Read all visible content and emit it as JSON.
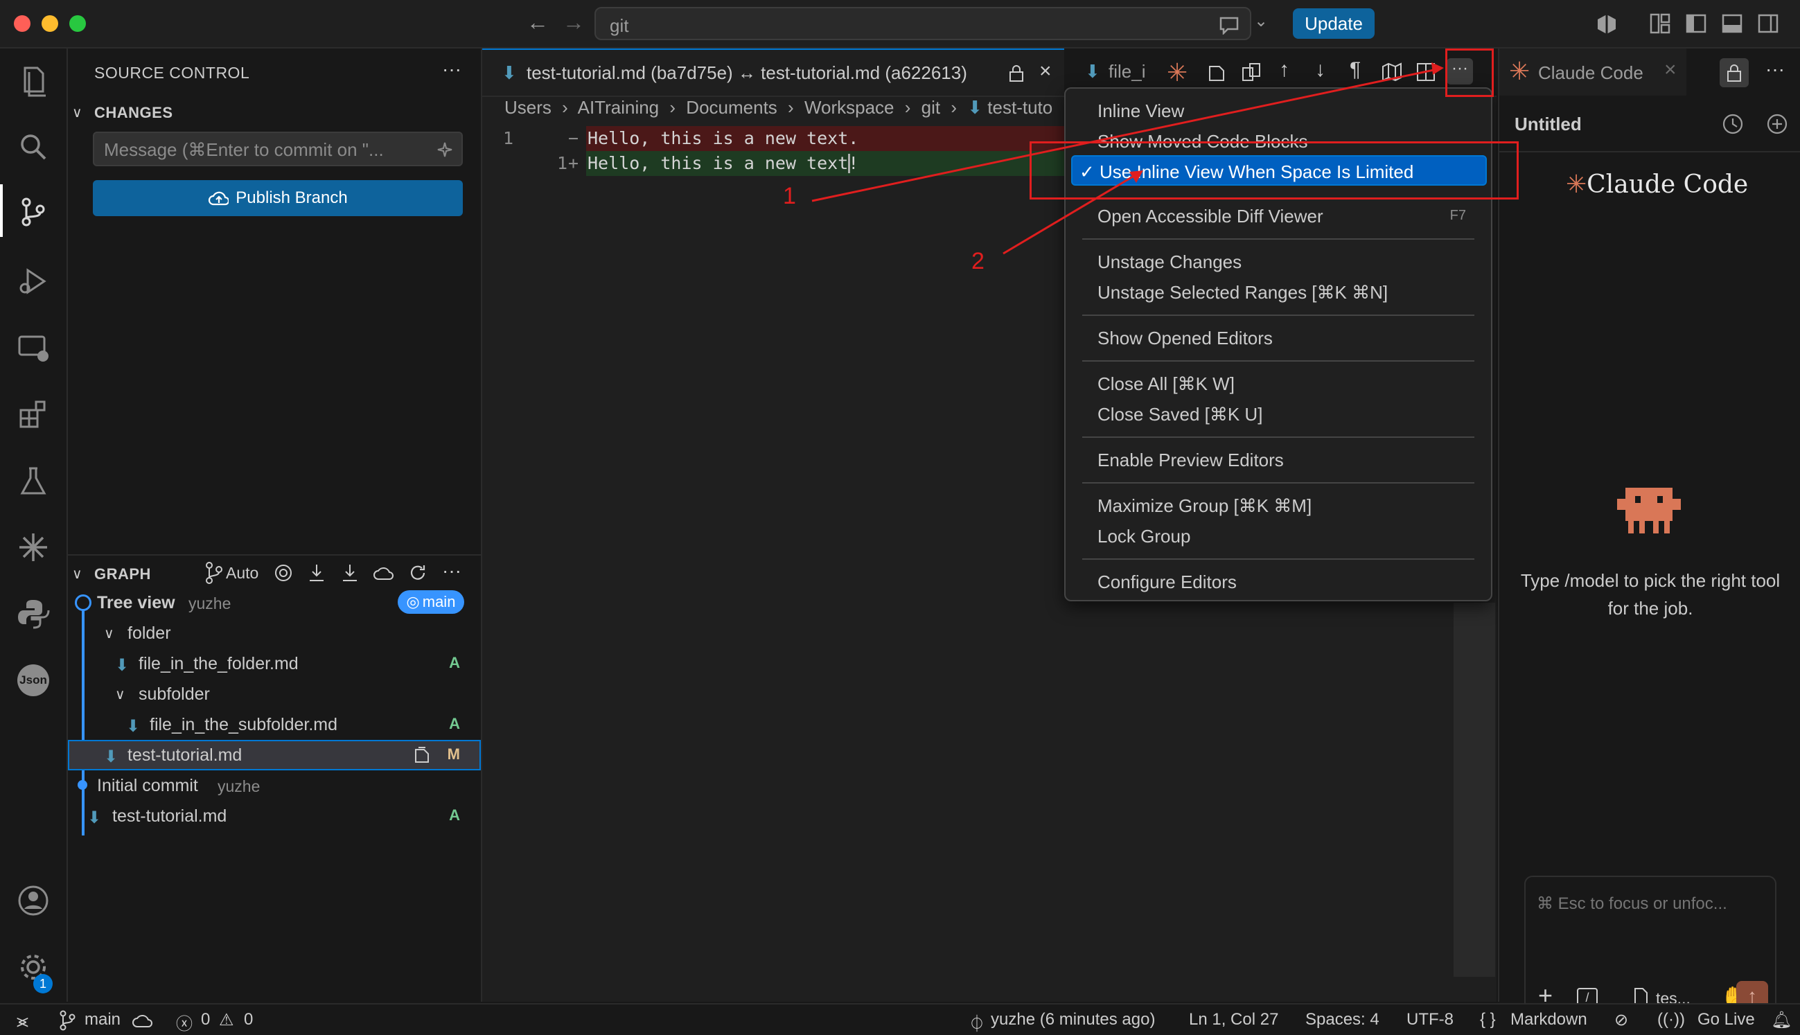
{
  "titlebar": {
    "search_text": "git",
    "update_label": "Update"
  },
  "activity": {
    "badge": "1",
    "json_label": "Json"
  },
  "sidebar": {
    "title": "SOURCE CONTROL",
    "changes_header": "CHANGES",
    "commit_placeholder": "Message (⌘Enter to commit on \"...",
    "publish_label": "Publish Branch",
    "graph_header": "GRAPH",
    "graph_auto": "Auto",
    "graph": {
      "commit1_title": "Tree view",
      "commit1_author": "yuzhe",
      "branch_badge": "main",
      "folder": "folder",
      "file1": "file_in_the_folder.md",
      "file1_status": "A",
      "subfolder": "subfolder",
      "file2": "file_in_the_subfolder.md",
      "file2_status": "A",
      "file3": "test-tutorial.md",
      "file3_status": "M",
      "commit2_title": "Initial commit",
      "commit2_author": "yuzhe",
      "file4": "test-tutorial.md",
      "file4_status": "A"
    }
  },
  "editor": {
    "tab1_label": "test-tutorial.md (ba7d75e) ↔ test-tutorial.md (a622613)",
    "tab2_label": "file_i",
    "breadcrumb": [
      "Users",
      "AITraining",
      "Documents",
      "Workspace",
      "git",
      "test-tuto"
    ],
    "line_old_num": "1",
    "line_new_num": "1",
    "line_old_text": "Hello, this is a new text.",
    "line_new_text": "Hello, this is a new text!"
  },
  "menu": {
    "items": [
      {
        "label": "Inline View"
      },
      {
        "label": "Show Moved Code Blocks"
      },
      {
        "label": "✓ Use Inline View When Space Is Limited"
      },
      {
        "label": "Open Accessible Diff Viewer",
        "key": "F7"
      },
      {
        "label": "Unstage Changes"
      },
      {
        "label": "Unstage Selected Ranges [⌘K ⌘N]"
      },
      {
        "label": "Show Opened Editors"
      },
      {
        "label": "Close All [⌘K W]"
      },
      {
        "label": "Close Saved [⌘K U]"
      },
      {
        "label": "Enable Preview Editors"
      },
      {
        "label": "Maximize Group [⌘K ⌘M]"
      },
      {
        "label": "Lock Group"
      },
      {
        "label": "Configure Editors"
      }
    ]
  },
  "annotations": {
    "label1": "1",
    "label2": "2"
  },
  "rightpanel": {
    "tab_label": "Claude Code",
    "session_title": "Untitled",
    "logo_text": "Claude Code",
    "hint": "Type /model to pick the right tool for the job.",
    "input_placeholder": "⌘ Esc to focus or unfoc...",
    "file_chip": "tes..."
  },
  "statusbar": {
    "branch": "main",
    "errors": "0",
    "warnings": "0",
    "blame": "yuzhe (6 minutes ago)",
    "position": "Ln 1, Col 27",
    "spaces": "Spaces: 4",
    "encoding": "UTF-8",
    "language": "Markdown",
    "golive": "Go Live"
  },
  "colors": {
    "accent": "#0e639c",
    "claude": "#d97757",
    "red_annotation": "#e01e1e"
  }
}
